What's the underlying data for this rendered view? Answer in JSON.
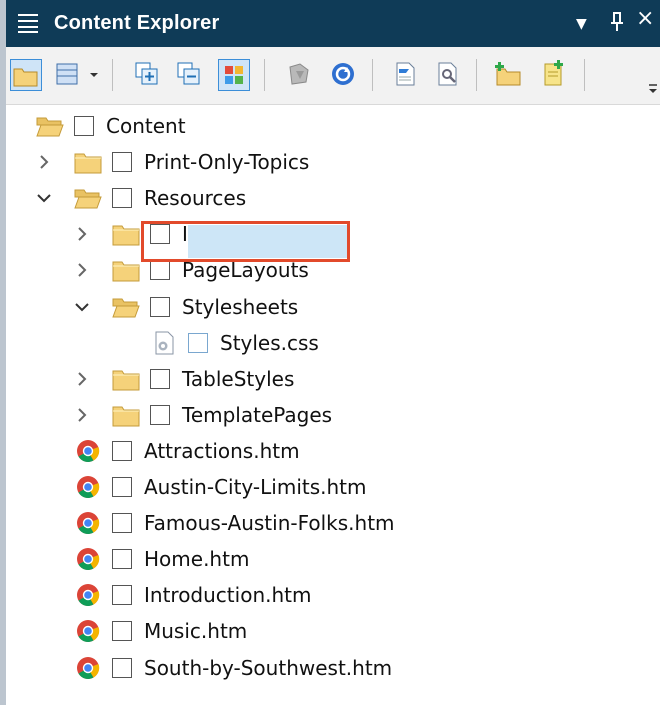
{
  "panel": {
    "title": "Content Explorer",
    "dropdown_glyph": "▼",
    "pin_glyph": "⊥",
    "close_glyph": "×"
  },
  "toolbar": {
    "tools": [
      {
        "name": "open-folder-tool-icon",
        "selected": true
      },
      {
        "name": "view-mode-tool-icon",
        "selected": false
      },
      {
        "name": "expand-all-tool-icon",
        "selected": false
      },
      {
        "name": "collapse-all-tool-icon",
        "selected": false
      },
      {
        "name": "color-tiles-tool-icon",
        "selected": true
      },
      {
        "name": "flare-file-tool-icon",
        "selected": false
      },
      {
        "name": "refresh-tool-icon",
        "selected": false
      },
      {
        "name": "document-tool-icon",
        "selected": false
      },
      {
        "name": "properties-tool-icon",
        "selected": false
      },
      {
        "name": "new-folder-tool-icon",
        "selected": false
      },
      {
        "name": "new-file-tool-icon",
        "selected": false
      }
    ]
  },
  "tree": {
    "items": [
      {
        "label": "Content",
        "level": 0,
        "icon": "folder-open-icon",
        "expander": ""
      },
      {
        "label": "Print-Only-Topics",
        "level": 1,
        "icon": "folder-icon",
        "expander": "collapsed"
      },
      {
        "label": "Resources",
        "level": 1,
        "icon": "folder-open-icon",
        "expander": "expanded"
      },
      {
        "label": "Images",
        "level": 2,
        "icon": "folder-icon",
        "expander": "collapsed"
      },
      {
        "label": "PageLayouts",
        "level": 2,
        "icon": "folder-icon",
        "expander": "collapsed"
      },
      {
        "label": "Stylesheets",
        "level": 2,
        "icon": "folder-open-icon",
        "expander": "expanded"
      },
      {
        "label": "Styles.css",
        "level": 3,
        "icon": "css-file-icon",
        "expander": "",
        "selected": true
      },
      {
        "label": "TableStyles",
        "level": 2,
        "icon": "folder-icon",
        "expander": "collapsed"
      },
      {
        "label": "TemplatePages",
        "level": 2,
        "icon": "folder-icon",
        "expander": "collapsed"
      },
      {
        "label": "Attractions.htm",
        "level": 1,
        "icon": "chrome-icon",
        "expander": ""
      },
      {
        "label": "Austin-City-Limits.htm",
        "level": 1,
        "icon": "chrome-icon",
        "expander": ""
      },
      {
        "label": "Famous-Austin-Folks.htm",
        "level": 1,
        "icon": "chrome-icon",
        "expander": ""
      },
      {
        "label": "Home.htm",
        "level": 1,
        "icon": "chrome-icon",
        "expander": ""
      },
      {
        "label": "Introduction.htm",
        "level": 1,
        "icon": "chrome-icon",
        "expander": ""
      },
      {
        "label": "Music.htm",
        "level": 1,
        "icon": "chrome-icon",
        "expander": ""
      },
      {
        "label": "South-by-Southwest.htm",
        "level": 1,
        "icon": "chrome-icon",
        "expander": ""
      }
    ]
  },
  "colors": {
    "titlebar": "#0f3b57",
    "highlight_border": "#e24a2b",
    "selection_bg": "#cde6f7",
    "folder": "#f5d27a"
  }
}
